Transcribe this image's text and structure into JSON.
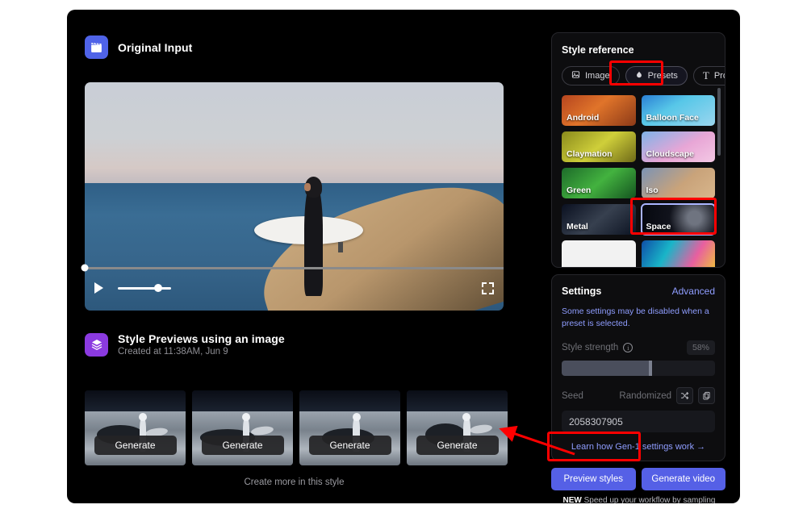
{
  "window": {
    "background": "#000000",
    "page_background": "#ffffff"
  },
  "colors": {
    "accent_blue": "#5560e6",
    "link_blue": "#8f9dff",
    "annotation_red": "#ff0000",
    "original_input_icon_bg": "#4f63e8",
    "style_previews_icon_bg": "#8b3ae0"
  },
  "original_input": {
    "title": "Original Input",
    "icon": "clapperboard-icon",
    "player": {
      "play_icon": "play-icon",
      "fullscreen_icon": "fullscreen-icon",
      "volume_percent": 75,
      "progress_percent": 0
    },
    "scene_description": "Surfer in wetsuit holding a white surfboard on a coastal cliff above the ocean"
  },
  "style_previews": {
    "title": "Style Previews using an image",
    "subtitle": "Created at 11:38AM, Jun 9",
    "icon": "layers-icon",
    "generate_label": "Generate",
    "items": [
      {
        "alt": "Astronaut with surfboard on lunar surface"
      },
      {
        "alt": "Astronaut walking on moon crater rim"
      },
      {
        "alt": "Astronaut standing beside moon crater"
      },
      {
        "alt": "Astronaut with board on rocky moon terrain"
      }
    ],
    "create_more_label": "Create more in this style"
  },
  "style_reference": {
    "title": "Style reference",
    "tabs": [
      {
        "label": "Image",
        "icon": "image-icon",
        "active": false
      },
      {
        "label": "Presets",
        "icon": "droplet-icon",
        "active": true
      },
      {
        "label": "Prompt",
        "icon": "text-t-icon",
        "active": false
      }
    ],
    "presets": [
      {
        "label": "Android",
        "selected": false
      },
      {
        "label": "Balloon Face",
        "selected": false
      },
      {
        "label": "Claymation",
        "selected": false
      },
      {
        "label": "Cloudscape",
        "selected": false
      },
      {
        "label": "Green",
        "selected": false
      },
      {
        "label": "Iso",
        "selected": false
      },
      {
        "label": "Metal",
        "selected": false
      },
      {
        "label": "Space",
        "selected": true
      },
      {
        "label": "",
        "selected": false
      },
      {
        "label": "",
        "selected": false
      }
    ],
    "scrollbar": {
      "thumb_percent": 40
    }
  },
  "settings": {
    "title": "Settings",
    "advanced_label": "Advanced",
    "note": "Some settings may be disabled when a preset is selected.",
    "style_strength": {
      "label": "Style strength",
      "info_icon": "info-icon",
      "value_label": "58%",
      "value": 58
    },
    "seed": {
      "label": "Seed",
      "mode_label": "Randomized",
      "shuffle_icon": "shuffle-icon",
      "copy_icon": "copy-icon",
      "value": "2058307905"
    },
    "learn_link": "Learn how Gen-1 settings work →"
  },
  "actions": {
    "preview_label": "Preview styles",
    "generate_label": "Generate video",
    "promo_badge": "NEW",
    "promo_text": " Speed up your workflow by sampling various styles for your video"
  }
}
